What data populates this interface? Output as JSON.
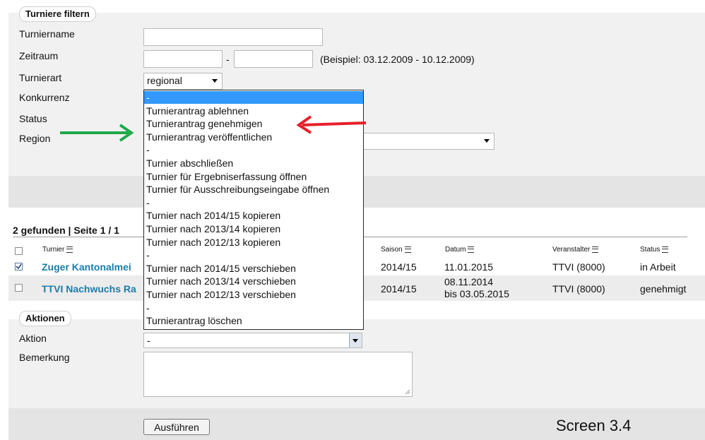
{
  "filter": {
    "legend": "Turniere filtern",
    "labels": {
      "name": "Turniername",
      "zeitraum": "Zeitraum",
      "art": "Turnierart",
      "konkurrenz": "Konkurrenz",
      "status": "Status",
      "region": "Region"
    },
    "zeitraum_sep": "-",
    "zeitraum_hint": "(Beispiel: 03.12.2009 - 10.12.2009)",
    "art_value": "regional"
  },
  "results": {
    "summary": "2 gefunden | Seite 1 / 1",
    "columns": [
      "Turnier",
      "Saison",
      "Datum",
      "Veranstalter",
      "Status"
    ],
    "rows": [
      {
        "name": "Zuger Kantonalmei",
        "saison": "2014/15",
        "datum1": "11.01.2015",
        "datum2": "",
        "veranstalter": "TTVI (8000)",
        "status": "in Arbeit",
        "checked": true
      },
      {
        "name": "TTVI Nachwuchs Ra",
        "saison": "2014/15",
        "datum1": "08.11.2014",
        "datum2": "bis 03.05.2015",
        "veranstalter": "TTVI (8000)",
        "status": "genehmigt",
        "checked": false
      }
    ]
  },
  "dropdown": {
    "options": [
      "-",
      "Turnierantrag ablehnen",
      "Turnierantrag genehmigen",
      "Turnierantrag veröffentlichen",
      "-",
      "Turnier abschließen",
      "Turnier für Ergebniserfassung öffnen",
      "Turnier für Ausschreibungseingabe öffnen",
      "-",
      "Turnier nach 2014/15 kopieren",
      "Turnier nach 2013/14 kopieren",
      "Turnier nach 2012/13 kopieren",
      "-",
      "Turnier nach 2014/15 verschieben",
      "Turnier nach 2013/14 verschieben",
      "Turnier nach 2012/13 verschieben",
      "-",
      "Turnierantrag löschen"
    ],
    "highlighted_index": 0
  },
  "actions": {
    "legend": "Aktionen",
    "aktion_label": "Aktion",
    "aktion_value": "-",
    "bemerkung_label": "Bemerkung",
    "submit_label": "Ausführen"
  },
  "caption": "Screen 3.4",
  "colors": {
    "green_arrow": "#1fa84a",
    "red_arrow": "#e8202a",
    "link": "#1b7ca8",
    "highlight": "#3399ff"
  },
  "icons": {
    "sort": "sort-lines-icon",
    "date_sort": "sort-desc-icon",
    "select_caret": "chevron-down-icon"
  }
}
